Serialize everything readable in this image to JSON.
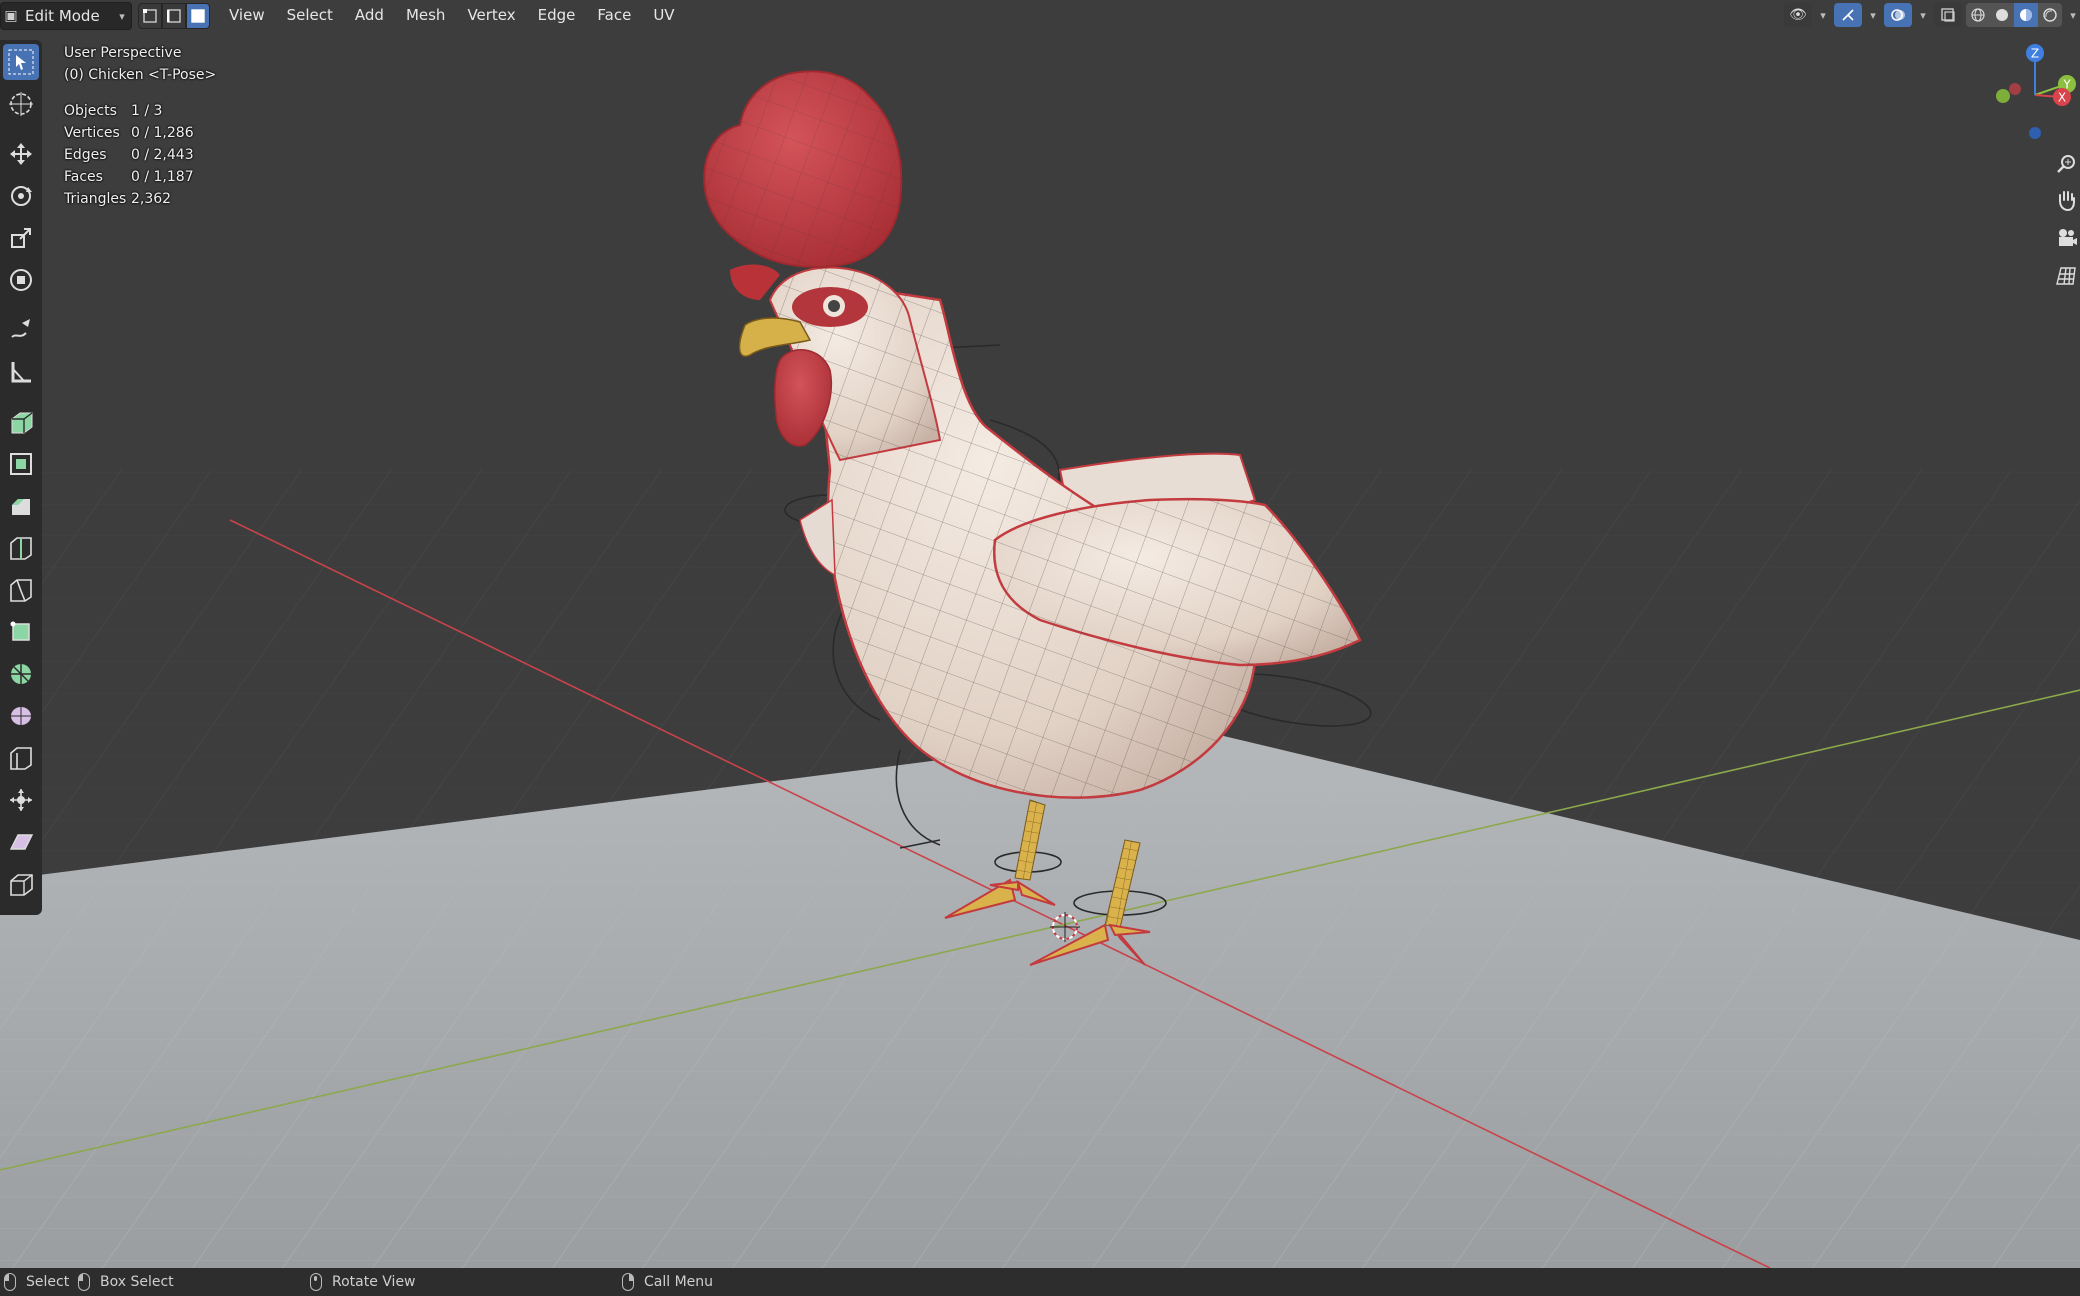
{
  "header": {
    "mode_label": "Edit Mode",
    "menus": [
      "View",
      "Select",
      "Add",
      "Mesh",
      "Vertex",
      "Edge",
      "Face",
      "UV"
    ]
  },
  "overlay": {
    "perspective": "User Perspective",
    "object": "(0) Chicken <T-Pose>"
  },
  "stats": [
    {
      "label": "Objects",
      "value": "1 / 3"
    },
    {
      "label": "Vertices",
      "value": "0 / 1,286"
    },
    {
      "label": "Edges",
      "value": "0 / 2,443"
    },
    {
      "label": "Faces",
      "value": "0 / 1,187"
    },
    {
      "label": "Triangles",
      "value": "2,362"
    }
  ],
  "gizmo": {
    "z": "Z",
    "y": "Y",
    "x": "X"
  },
  "statusbar": {
    "select": "Select",
    "box_select": "Box Select",
    "rotate_view": "Rotate View",
    "call_menu": "Call Menu"
  },
  "colors": {
    "accent": "#4772b3",
    "axis_x": "#d9434a",
    "axis_y": "#8cbf3f",
    "axis_z": "#3f7fe0",
    "comb_red": "#c33a3f",
    "ground": "#a8abae"
  }
}
